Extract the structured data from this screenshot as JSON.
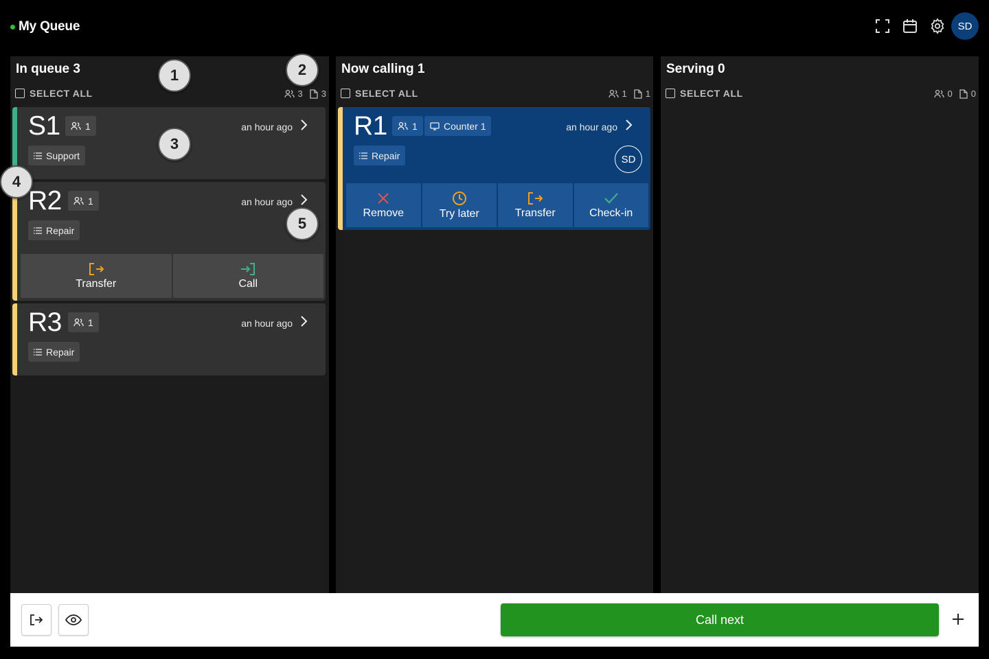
{
  "header": {
    "title": "My Queue",
    "user_initials": "SD"
  },
  "columns": [
    {
      "title": "In queue 3",
      "select_all": "SELECT ALL",
      "people_count": "3",
      "doc_count": "3"
    },
    {
      "title": "Now calling 1",
      "select_all": "SELECT ALL",
      "people_count": "1",
      "doc_count": "1"
    },
    {
      "title": "Serving 0",
      "select_all": "SELECT ALL",
      "people_count": "0",
      "doc_count": "0"
    }
  ],
  "queue": [
    {
      "ticket": "S1",
      "people": "1",
      "service": "Support",
      "time": "an hour ago"
    },
    {
      "ticket": "R2",
      "people": "1",
      "service": "Repair",
      "time": "an hour ago",
      "actions": [
        "Transfer",
        "Call"
      ]
    },
    {
      "ticket": "R3",
      "people": "1",
      "service": "Repair",
      "time": "an hour ago"
    }
  ],
  "calling": [
    {
      "ticket": "R1",
      "people": "1",
      "counter": "Counter 1",
      "service": "Repair",
      "time": "an hour ago",
      "assignee": "SD",
      "actions": [
        "Remove",
        "Try later",
        "Transfer",
        "Check-in"
      ]
    }
  ],
  "markers": [
    "1",
    "2",
    "3",
    "4",
    "5"
  ],
  "footer": {
    "call_next": "Call next"
  },
  "colors": {
    "accent_green": "#22931f",
    "calling_blue": "#0c3e77",
    "repair_bar": "#f7cf74",
    "support_bar": "#3fb08a",
    "transfer_icon": "#f0a020",
    "call_icon": "#3fb08a",
    "remove_icon": "#e5534b"
  }
}
